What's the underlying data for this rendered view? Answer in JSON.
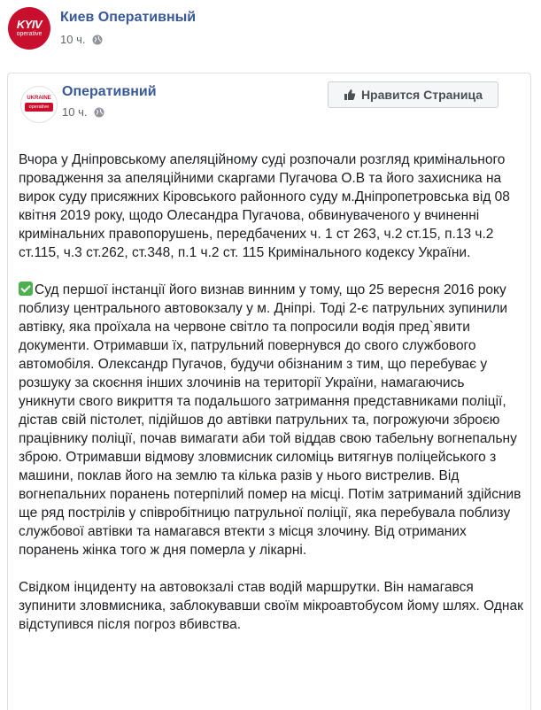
{
  "outer_post": {
    "page_name": "Киев Оперативный",
    "time": "10 ч.",
    "avatar_logo_text": "KYIV",
    "avatar_logo_sub": "operative"
  },
  "shared_post": {
    "page_name": "Оперативний",
    "time": "10 ч.",
    "avatar_logo_top": "UKRAINE",
    "avatar_logo_bar": "operative",
    "like_button_label": "Нравится Страница",
    "paragraph1": "Вчора у Дніпровському апеляційному суді розпочали розгляд кримінального провадження за апеляційними скаргами Пугачова О.В та його захисника на вирок суду присяжних Кіровського районного суду м.Дніпропетровська від 08 квітня 2019 року, щодо Олесандра Пугачова, обвинуваченого у вчиненні кримінальних правопорушень, передбачених ч. 1 ст 263, ч.2 ст.15, п.13 ч.2 ст.115, ч.3 ст.262, ст.348, п.1 ч.2 ст. 115 Кримінального кодексу України.",
    "paragraph2": "Суд першої інстанції його визнав винним у тому, що 25 вересня 2016 року поблизу центрального автовокзалу у м. Дніпрі. Тоді 2-є патрульних зупинили автівку, яка проїхала на червоне світло та попросили водія пред`явити документи. Отримавши їх, патрульний повернувся до свого службового автомобіля. Олександр Пугачов, будучи обізнаним з тим, що перебуває у розшуку за скоєння інших злочинів на території України, намагаючись уникнути свого викриття та подальшого затримання представниками поліції, дістав свій пістолет, підійшов до автівки патрульних та, погрожуючи зброєю працівнику поліції, почав вимагати аби той віддав свою табельну вогнепальну зброю. Отримавши відмову зловмисник силоміць витягнув поліцейського з машини, поклав його на землю та кілька разів у нього вистрелив. Від вогнепальних поранень потерпілий помер на місці. Потім затриманий здійснив ще ряд пострілів у співробітницю патрульної поліції, яка перебувала поблизу службової автівки та намагався втекти з місця злочину. Від отриманих поранень жінка того ж дня померла у лікарні.",
    "paragraph3": "Свідком інциденту на автовокзалі став водій маршрутки. Він намагався зупинити зловмисника, заблокувавши своїм мікроавтобусом йому шлях. Однак відступився після погроз вбивства."
  },
  "colors": {
    "link_blue": "#385898",
    "brand_red": "#c8102e",
    "check_green": "#4caf50"
  },
  "icons": [
    "globe-icon",
    "thumbs-up-icon",
    "check-mark-icon"
  ]
}
